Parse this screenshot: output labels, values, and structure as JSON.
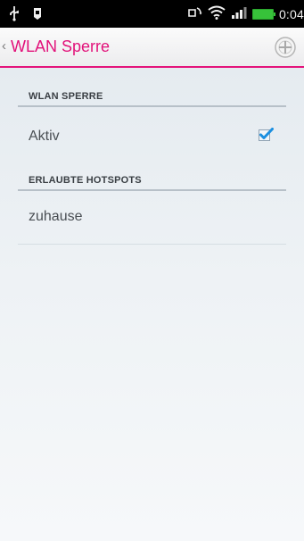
{
  "status_bar": {
    "time": "0:04",
    "left_icons": [
      "usb-icon",
      "notification-icon"
    ],
    "right_icons": [
      "rotation-icon",
      "wifi-icon",
      "signal-icon",
      "battery-icon"
    ],
    "battery_color": "#37c23a"
  },
  "action_bar": {
    "title": "WLAN Sperre",
    "accent_color": "#e4137b",
    "add_icon": "add-circle-icon"
  },
  "sections": [
    {
      "header": "WLAN SPERRE",
      "items": [
        {
          "label": "Aktiv",
          "checked": true
        }
      ]
    },
    {
      "header": "ERLAUBTE HOTSPOTS",
      "items": [
        {
          "label": "zuhause"
        }
      ]
    }
  ]
}
